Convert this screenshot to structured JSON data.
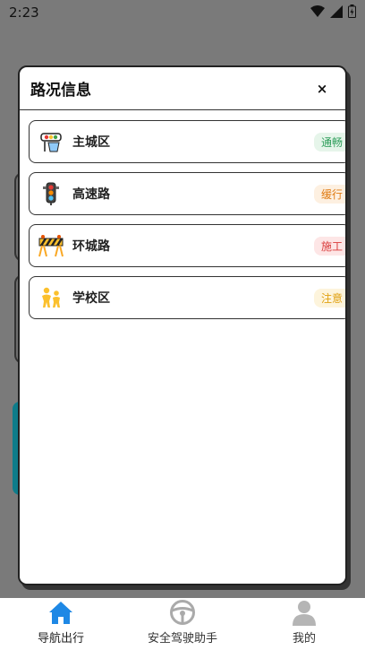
{
  "status_bar": {
    "time": "2:23"
  },
  "dialog": {
    "title": "路况信息",
    "close_label": "×",
    "items": [
      {
        "name": "主城区",
        "status": "通畅",
        "status_color": "#2e9e5b",
        "status_bg": "#e6f5ea",
        "icon": "city-road-icon"
      },
      {
        "name": "高速路",
        "status": "缓行",
        "status_color": "#e07b12",
        "status_bg": "#fdf0e1",
        "icon": "traffic-light-icon"
      },
      {
        "name": "环城路",
        "status": "施工",
        "status_color": "#d93b3b",
        "status_bg": "#fde6e6",
        "icon": "construction-barrier-icon"
      },
      {
        "name": "学校区",
        "status": "注意",
        "status_color": "#e0a010",
        "status_bg": "#fdf4dc",
        "icon": "school-children-icon"
      }
    ]
  },
  "bottom_nav": {
    "items": [
      {
        "label": "导航出行",
        "icon": "home-icon",
        "active": true,
        "color": "#1e88e5"
      },
      {
        "label": "安全驾驶助手",
        "icon": "steering-wheel-icon",
        "active": false
      },
      {
        "label": "我的",
        "icon": "person-icon",
        "active": false
      }
    ]
  }
}
